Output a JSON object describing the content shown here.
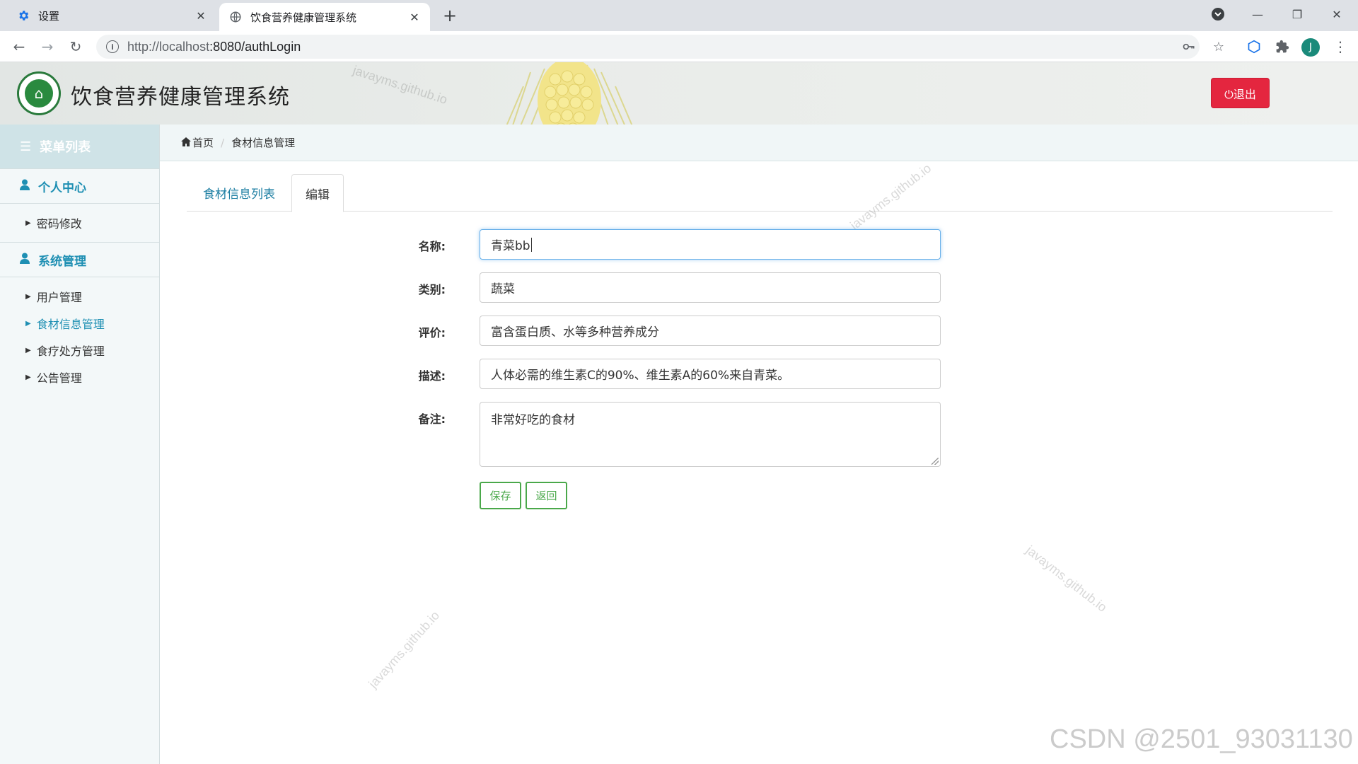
{
  "browser": {
    "tabs": [
      {
        "title": "设置",
        "icon": "gear-icon",
        "active": false
      },
      {
        "title": "饮食营养健康管理系统",
        "icon": "globe-icon",
        "active": true
      }
    ],
    "url": {
      "host": "http://localhost",
      "path": ":8080/authLogin"
    },
    "profile_initial": "J"
  },
  "app": {
    "title": "饮食营养健康管理系统",
    "logout_label": "⏻退出",
    "watermark_text": "javayms.github.io"
  },
  "sidebar": {
    "header": "菜单列表",
    "groups": [
      {
        "title": "个人中心",
        "items": [
          {
            "label": "密码修改",
            "active": false
          }
        ]
      },
      {
        "title": "系统管理",
        "items": [
          {
            "label": "用户管理",
            "active": false
          },
          {
            "label": "食材信息管理",
            "active": true
          },
          {
            "label": "食疗处方管理",
            "active": false
          },
          {
            "label": "公告管理",
            "active": false
          }
        ]
      }
    ]
  },
  "breadcrumb": {
    "home": "首页",
    "current": "食材信息管理"
  },
  "content_tabs": {
    "list": "食材信息列表",
    "edit": "编辑"
  },
  "form": {
    "fields": [
      {
        "label": "名称:",
        "value": "青菜bb"
      },
      {
        "label": "类别:",
        "value": "蔬菜"
      },
      {
        "label": "评价:",
        "value": "富含蛋白质、水等多种营养成分"
      },
      {
        "label": "描述:",
        "value": "人体必需的维生素C的90%、维生素A的60%来自青菜。"
      },
      {
        "label": "备注:",
        "value": "非常好吃的食材"
      }
    ],
    "save_label": "保存",
    "back_label": "返回"
  },
  "footer_watermark": "CSDN @2501_93031130",
  "colors": {
    "accent": "#1e8fb3",
    "logout": "#e4263f",
    "button_green": "#4aa84a"
  }
}
